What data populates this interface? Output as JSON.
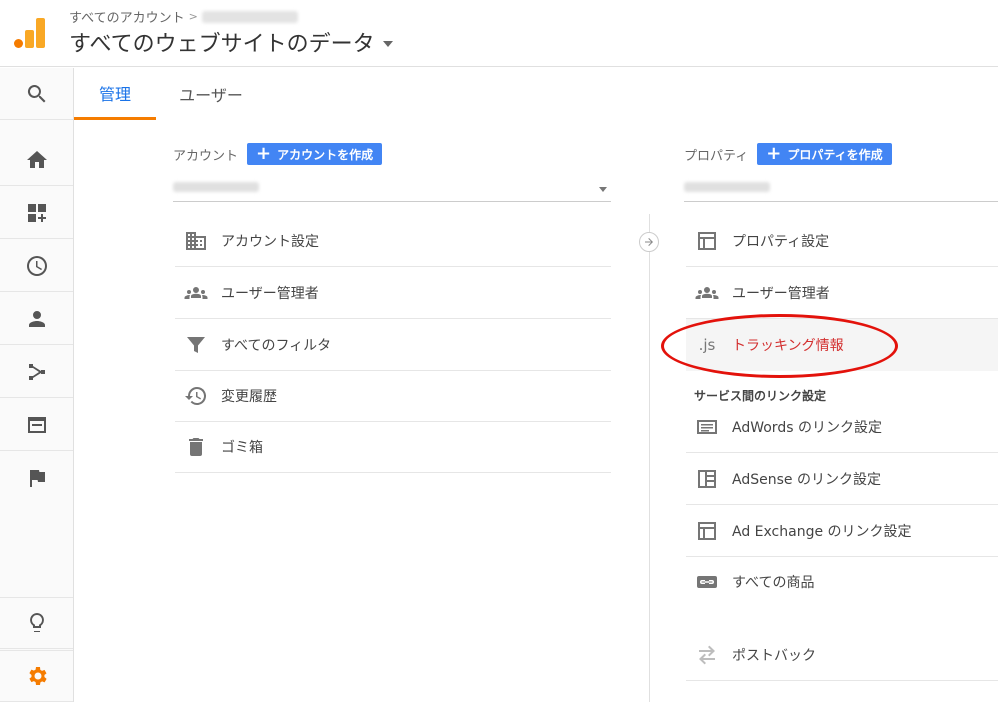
{
  "header": {
    "breadcrumb_root": "すべてのアカウント",
    "breadcrumb_sep": ">",
    "view_title": "すべてのウェブサイトのデータ"
  },
  "rail": {
    "items": [
      "search-icon",
      "home-icon",
      "customization-icon",
      "realtime-icon",
      "audience-icon",
      "acquisition-icon",
      "behavior-icon",
      "conversions-icon",
      "discover-icon",
      "admin-gear-icon"
    ],
    "active_color": "#f57c00"
  },
  "tabs": {
    "admin": "管理",
    "user": "ユーザー"
  },
  "account": {
    "heading": "アカウント",
    "create_label": "アカウントを作成",
    "items": [
      {
        "label": "アカウント設定",
        "icon": "building-icon"
      },
      {
        "label": "ユーザー管理者",
        "icon": "users-icon"
      },
      {
        "label": "すべてのフィルタ",
        "icon": "filter-icon"
      },
      {
        "label": "変更履歴",
        "icon": "history-icon"
      },
      {
        "label": "ゴミ箱",
        "icon": "trash-icon"
      }
    ]
  },
  "property": {
    "heading": "プロパティ",
    "create_label": "プロパティを作成",
    "items": [
      {
        "label": "プロパティ設定",
        "icon": "property-icon"
      },
      {
        "label": "ユーザー管理者",
        "icon": "users-icon"
      },
      {
        "label": "トラッキング情報",
        "icon": "js-icon",
        "icon_text": ".js"
      }
    ],
    "link_section": "サービス間のリンク設定",
    "link_items": [
      {
        "label": "AdWords のリンク設定",
        "icon": "adwords-icon"
      },
      {
        "label": "AdSense のリンク設定",
        "icon": "adsense-icon"
      },
      {
        "label": "Ad Exchange のリンク設定",
        "icon": "adexchange-icon"
      },
      {
        "label": "すべての商品",
        "icon": "link-icon"
      }
    ],
    "extra_items": [
      {
        "label": "ポストバック",
        "icon": "postback-icon"
      }
    ]
  },
  "colors": {
    "accent_blue": "#4285f4",
    "tab_active": "#1a73e8",
    "highlight_red": "#d32f2f",
    "annotation_red": "#e3120b"
  }
}
